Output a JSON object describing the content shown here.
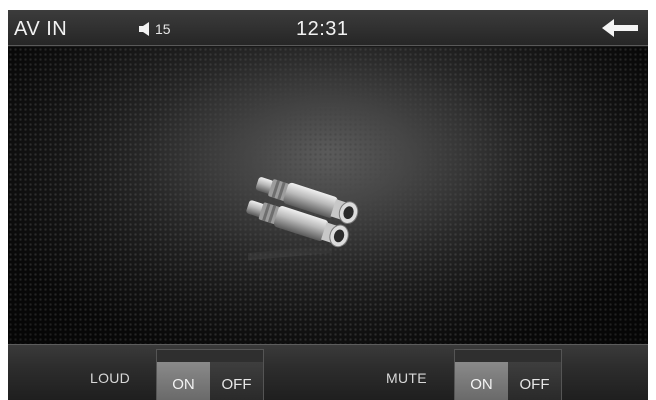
{
  "header": {
    "title": "AV IN",
    "volume": "15",
    "time": "12:31"
  },
  "controls": {
    "loud": {
      "label": "LOUD",
      "on_label": "ON",
      "off_label": "OFF",
      "state": "ON"
    },
    "mute": {
      "label": "MUTE",
      "on_label": "ON",
      "off_label": "OFF",
      "state": "ON"
    }
  },
  "icons": {
    "speaker": "speaker-icon",
    "back": "back-arrow-icon",
    "connectors": "rca-connectors-icon"
  },
  "colors": {
    "header_bg": "#2e2e2e",
    "grille_bg": "#141414",
    "toggle_on": "#7a7a7a",
    "toggle_off": "#333333",
    "text": "#f2f2f2"
  }
}
